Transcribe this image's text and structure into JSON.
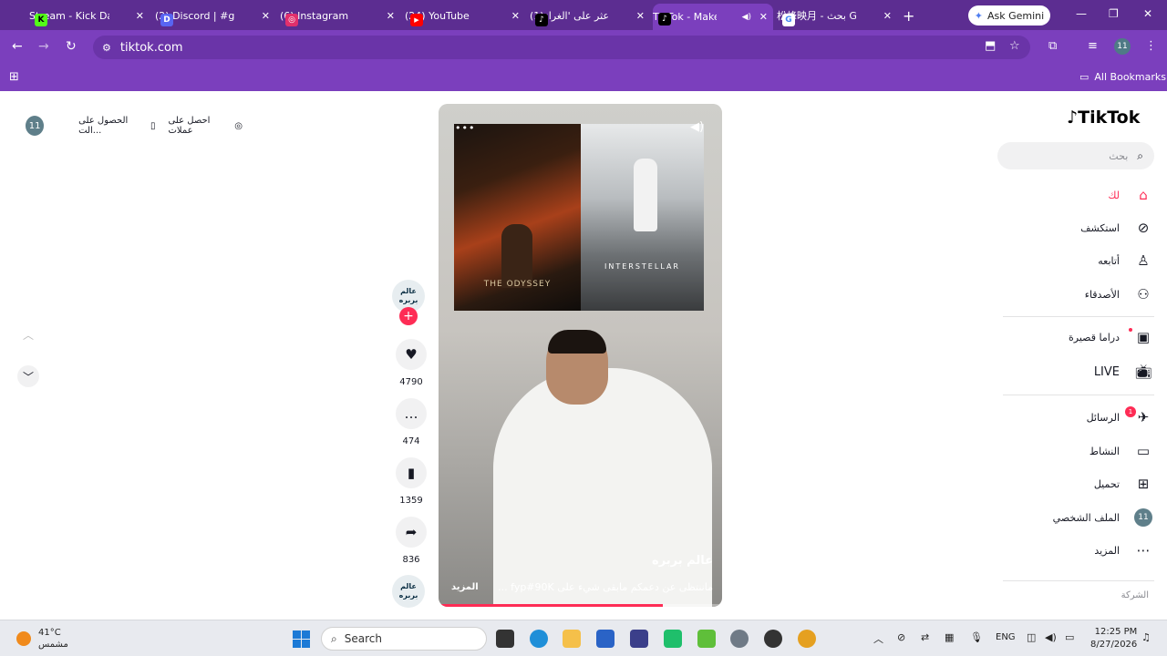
{
  "browser": {
    "tabs": [
      {
        "label": "Stream - Kick Das",
        "icon_color": "#53fc18",
        "icon_text": "K",
        "icon": "kick-icon"
      },
      {
        "label": "(2) Discord | #gen",
        "icon_color": "#5865f2",
        "icon_text": "D",
        "icon": "discord-icon"
      },
      {
        "label": "(6) Instagram",
        "icon_color": "#e1306c",
        "icon_text": "◎",
        "icon": "instagram-icon"
      },
      {
        "label": "(24) YouTube",
        "icon_color": "#ff0000",
        "icon_text": "▶",
        "icon": "youtube-icon"
      },
      {
        "label": "(1)اعثر على 'الغراء",
        "icon_color": "#000000",
        "icon_text": "♪",
        "icon": "tiktok-icon"
      },
      {
        "label": "TikTok - Make",
        "icon_color": "#000000",
        "icon_text": "♪",
        "icon": "tiktok-icon",
        "active": true
      },
      {
        "label": "松峰映月 - بحث G",
        "icon_color": "#ffffff",
        "icon_text": "G",
        "icon": "google-icon"
      }
    ],
    "ask_gemini": "Ask Gemini",
    "url": "tiktok.com",
    "bookmarks_label": "All Bookmarks",
    "profile_initials": "11"
  },
  "tiktok": {
    "logo": "TikTok",
    "search_placeholder": "بحث",
    "nav": [
      {
        "label": "لك",
        "icon": "home-icon",
        "active": true
      },
      {
        "label": "استكشف",
        "icon": "compass-icon"
      },
      {
        "label": "أتابعه",
        "icon": "following-icon"
      },
      {
        "label": "الأصدقاء",
        "icon": "friends-icon"
      },
      {
        "label": "دراما قصيرة",
        "icon": "drama-icon"
      },
      {
        "label": "LIVE",
        "icon": "live-icon"
      },
      {
        "label": "الرسائل",
        "icon": "messages-icon",
        "badge": "1"
      },
      {
        "label": "النشاط",
        "icon": "activity-icon"
      },
      {
        "label": "تحميل",
        "icon": "upload-icon"
      },
      {
        "label": "الملف الشخصي",
        "icon": "profile-avatar",
        "avatar_text": "11"
      },
      {
        "label": "المزيد",
        "icon": "more-icon"
      }
    ],
    "footer_label": "الشركة",
    "topbar": {
      "avatar_text": "11",
      "get_app": "الحصول على الت...",
      "get_coins": "احصل على عملات"
    },
    "video": {
      "poster_left_title": "THE ODYSSEY",
      "poster_right_title": "INTERSTELLAR",
      "author": "عالم بربره",
      "caption": "ماننتظى عن دعمكم مابقى شيء على fyp#90K ...",
      "more": "المزيد",
      "progress": 0.79
    },
    "actions": {
      "avatar_text": "عالم بربره",
      "likes": "4790",
      "comments": "474",
      "saves": "1359",
      "shares": "836"
    }
  },
  "taskbar": {
    "temperature": "41°C",
    "weather_desc": "مشمس",
    "search": "Search",
    "lang": "ENG",
    "time": "12:25 PM",
    "date": "8/27/2026"
  }
}
